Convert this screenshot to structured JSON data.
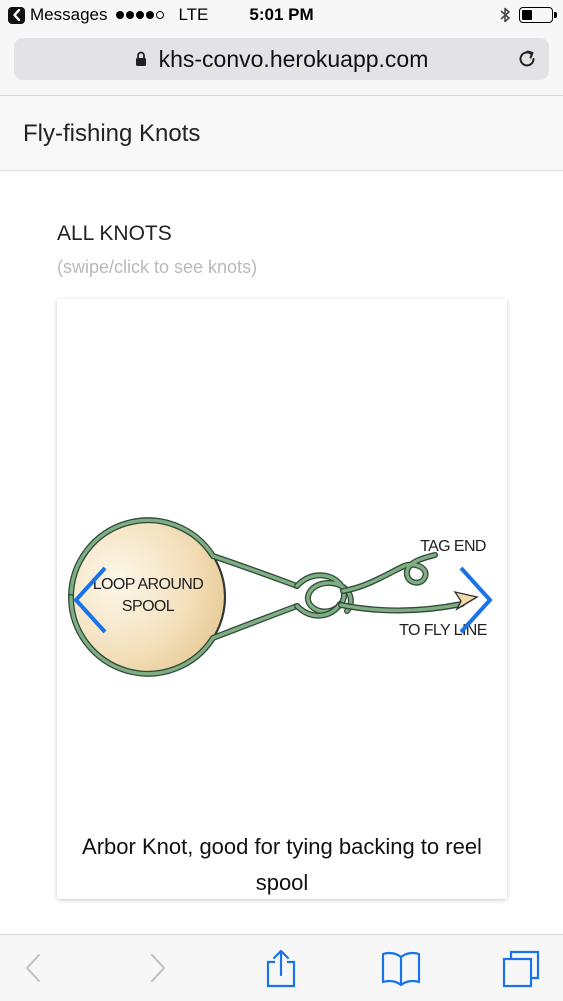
{
  "status_bar": {
    "back_app": "Messages",
    "signal_bars_filled": 4,
    "signal_bars_total": 5,
    "network": "LTE",
    "time": "5:01 PM",
    "bluetooth_icon": "bluetooth-icon",
    "battery_level": 0.35
  },
  "browser": {
    "url": "khs-convo.herokuapp.com",
    "lock_icon": "lock-icon",
    "reload_icon": "reload-icon"
  },
  "page": {
    "title": "Fly-fishing Knots",
    "section_title": "ALL KNOTS",
    "section_hint": "(swipe/click to see knots)"
  },
  "carousel": {
    "caption": "Arbor Knot, good for tying backing to reel spool",
    "figure_labels": {
      "spool_line1": "LOOP AROUND",
      "spool_line2": "SPOOL",
      "tag_end": "TAG END",
      "fly_line": "TO FLY LINE"
    },
    "arrow_color": "#1a73e8",
    "line_color": "#6e9c74",
    "spool_color_light": "#fbf4e6",
    "spool_color_dark": "#e8cc96"
  },
  "toolbar": {
    "icons": [
      "back-icon",
      "forward-icon",
      "share-icon",
      "bookmarks-icon",
      "tabs-icon"
    ],
    "tint": "#1a73e8",
    "disabled_tint": "#c4c4c8"
  }
}
